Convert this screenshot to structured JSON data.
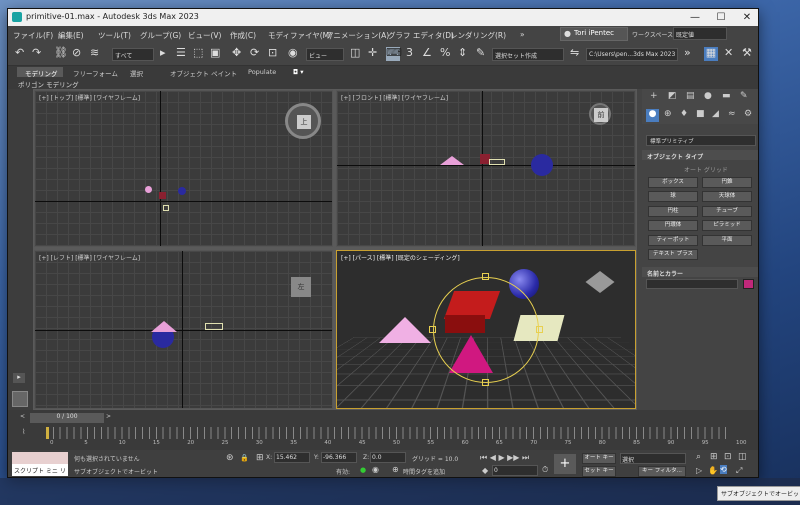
{
  "window": {
    "title": "primitive-01.max - Autodesk 3ds Max 2023",
    "min": "—",
    "max": "☐",
    "close": "✕"
  },
  "menu": [
    "ファイル(F)",
    "編集(E)",
    "ツール(T)",
    "グループ(G)",
    "ビュー(V)",
    "作成(C)",
    "モディファイヤ(M)",
    "アニメーション(A)",
    "グラフ エディタ(D)",
    "レンダリング(R)"
  ],
  "user": "Tori iPentec",
  "workspace_label": "ワークスペース:",
  "workspace_value": "既定値",
  "toolbar": {
    "filter": "すべて",
    "view": "ビュー",
    "selset": "選択セット作成",
    "path": "C:\\Users\\pen...3ds Max 2023"
  },
  "ribbon": {
    "tabs": [
      "モデリング",
      "フリーフォーム",
      "選択",
      "オブジェクト ペイント",
      "Populate"
    ],
    "sub": "ポリゴン モデリング"
  },
  "viewports": {
    "top": "[+] [トップ] [標準] [ワイヤフレーム]",
    "front": "[+] [フロント] [標準] [ワイヤフレーム]",
    "left": "[+] [レフト] [標準] [ワイヤフレーム]",
    "persp": "[+] [パース] [標準] [既定のシェーディング]",
    "cube_top": "上",
    "cube_front": "前",
    "cube_left": "左"
  },
  "panel": {
    "category": "標準プリミティブ",
    "rollout1": "オブジェクト タイプ",
    "autogrid": "オート グリッド",
    "buttons": [
      "ボックス",
      "円錐",
      "球",
      "天球体",
      "円柱",
      "チューブ",
      "円環体",
      "ピラミッド",
      "ティーポット",
      "平面",
      "テキスト プラス"
    ],
    "rollout2": "名前とカラー",
    "swatch": "#c0287a"
  },
  "timeline": {
    "frame": "0 / 100",
    "ticks": [
      "0",
      "5",
      "10",
      "15",
      "20",
      "25",
      "30",
      "35",
      "40",
      "45",
      "50",
      "55",
      "60",
      "65",
      "70",
      "75",
      "80",
      "85",
      "90",
      "95",
      "100"
    ]
  },
  "status": {
    "script": "スクリプト ミニ リス",
    "msg1": "何も選択されていません",
    "msg2": "サブオブジェクトでオービット",
    "x": "15.462",
    "y": "-96.366",
    "z": "0.0",
    "grid": "グリッド = 10.0",
    "enabled": "有効:",
    "timetag": "時間タグを追加",
    "autokey": "オート キー",
    "select": "選択",
    "setkey": "セット キー",
    "keyfilter": "キー フィルタ...",
    "frame": "0"
  },
  "tooltip": "サブオブジェクトでオービット"
}
